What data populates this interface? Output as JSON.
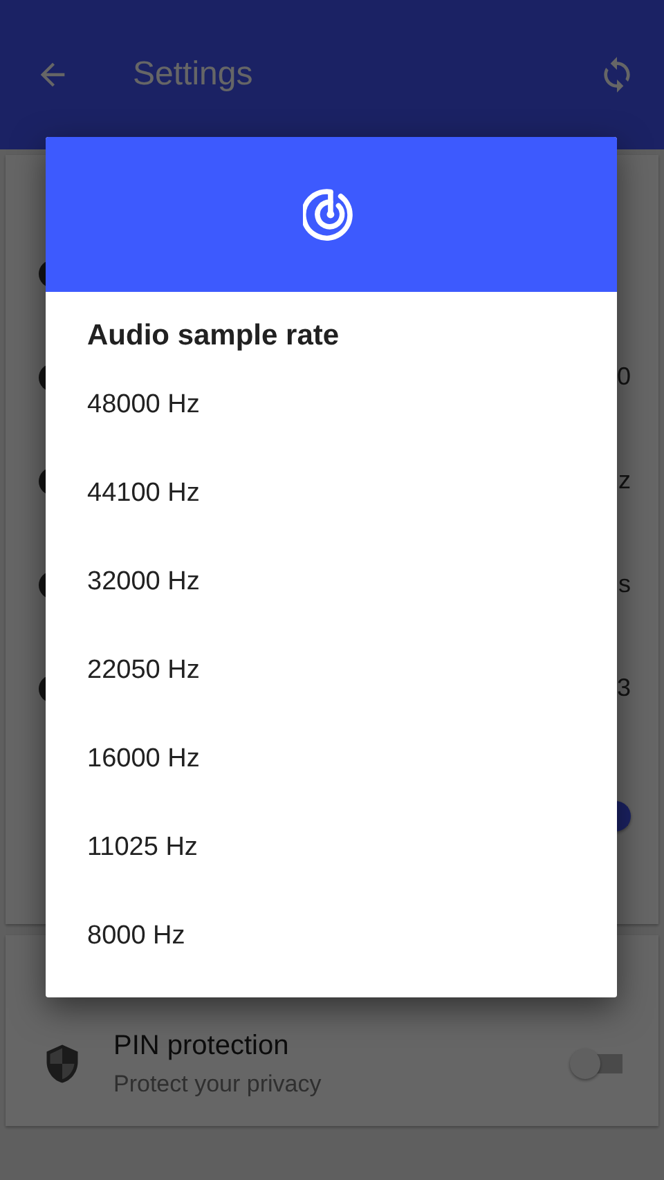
{
  "app_bar": {
    "title": "Settings"
  },
  "sections": [
    {
      "rows": [
        {
          "kind": "blank"
        },
        {
          "kind": "value",
          "value": "0"
        },
        {
          "kind": "value",
          "value": "z"
        },
        {
          "kind": "value",
          "value": "s"
        },
        {
          "kind": "value",
          "value": "3"
        },
        {
          "kind": "toggle",
          "on": true
        }
      ]
    },
    {
      "rows": [
        {
          "kind": "switch_item",
          "title": "PIN protection",
          "subtitle": "Protect your privacy",
          "on": false
        }
      ]
    }
  ],
  "dialog": {
    "title": "Audio sample rate",
    "options": [
      "48000 Hz",
      "44100 Hz",
      "32000 Hz",
      "22050 Hz",
      "16000 Hz",
      "11025 Hz",
      "8000 Hz"
    ]
  }
}
